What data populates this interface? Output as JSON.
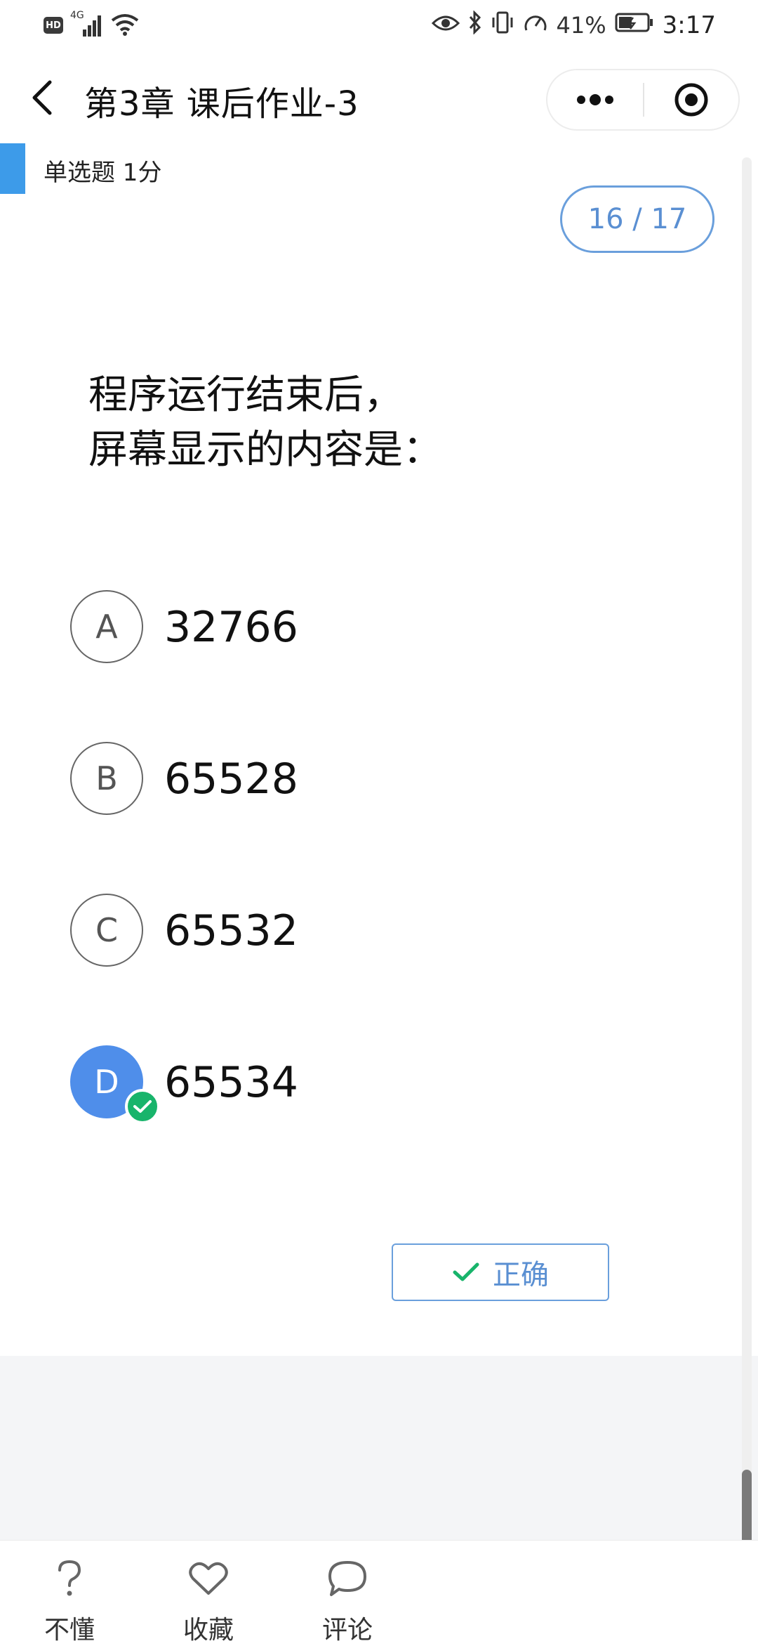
{
  "status_bar": {
    "hd": "HD",
    "network": "4G",
    "battery_percent": "41%",
    "time": "3:17",
    "icons": [
      "hd-icon",
      "signal-icon",
      "wifi-icon",
      "eye-icon",
      "bluetooth-icon",
      "vibrate-icon",
      "speed-icon",
      "battery-icon"
    ]
  },
  "header": {
    "title": "第3章 课后作业-3",
    "back_icon": "chevron-left-icon",
    "more_icon": "more-dots-icon",
    "close_icon": "target-icon"
  },
  "question": {
    "type_label": "单选题 1分",
    "progress": "16 / 17",
    "text_line1": "程序运行结束后，",
    "text_line2": "屏幕显示的内容是：",
    "options": [
      {
        "letter": "A",
        "text": "32766",
        "selected": false
      },
      {
        "letter": "B",
        "text": "65528",
        "selected": false
      },
      {
        "letter": "C",
        "text": "65532",
        "selected": false
      },
      {
        "letter": "D",
        "text": "65534",
        "selected": true
      }
    ],
    "result_label": "正确"
  },
  "bottom_bar": {
    "items": [
      {
        "label": "不懂",
        "icon": "question-icon"
      },
      {
        "label": "收藏",
        "icon": "heart-icon"
      },
      {
        "label": "评论",
        "icon": "comment-icon"
      }
    ]
  },
  "colors": {
    "accent_blue": "#4f8eea",
    "pill_blue": "#6a9fdc",
    "type_bar_blue": "#3d9be9",
    "correct_green": "#18b46b",
    "gray_bg": "#f4f5f7"
  }
}
